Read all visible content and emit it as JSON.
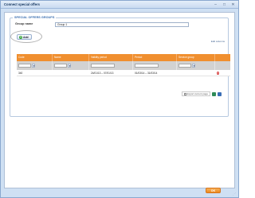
{
  "window": {
    "title": "Connect special offers",
    "controls": {
      "minimize": "–",
      "maximize": "□",
      "close": "✕"
    }
  },
  "fieldset": {
    "legend": "SPECIAL OFFERS GROUPS"
  },
  "form": {
    "group_name_label": "Group name",
    "group_name_value": "Group 1"
  },
  "toolbar": {
    "add_label": "Add",
    "add_icon": "plus-icon"
  },
  "grid": {
    "columns": [
      "Code",
      "Name",
      "Validity period",
      "Period",
      "Service group",
      ""
    ],
    "filter_dropdown_glyph": "▼",
    "rows": [
      {
        "code": "340",
        "name": "",
        "validity": "24/01/13 – 07/01/13",
        "period": "01/03/14 – 31/03/14",
        "service_group": "",
        "delete_glyph": "✕"
      }
    ],
    "edit_columns": "Edit columns"
  },
  "export": {
    "label": "Export current page"
  },
  "footer": {
    "ok_label": "OK"
  },
  "colors": {
    "accent": "#f08f2f",
    "frame": "#cfe0f3",
    "delete": "#d02a2a"
  }
}
